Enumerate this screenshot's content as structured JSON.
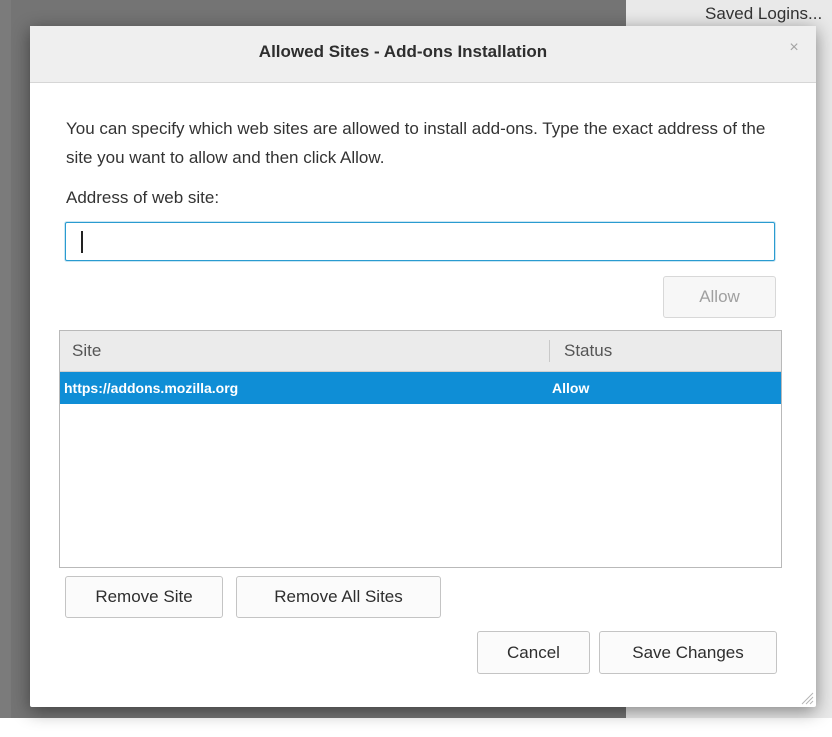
{
  "background": {
    "saved_logins_label": "Saved Logins..."
  },
  "dialog": {
    "title": "Allowed Sites - Add-ons Installation",
    "close_icon": "close-icon",
    "description": "You can specify which web sites are allowed to install add-ons. Type the exact address of the site you want to allow and then click Allow.",
    "address_label": "Address of web site:",
    "address_value": "",
    "address_placeholder": "",
    "allow_label": "Allow",
    "table": {
      "columns": [
        "Site",
        "Status"
      ],
      "rows": [
        {
          "site": "https://addons.mozilla.org",
          "status": "Allow"
        }
      ]
    },
    "remove_site_label": "Remove Site",
    "remove_all_label": "Remove All Sites",
    "cancel_label": "Cancel",
    "save_label": "Save Changes"
  },
  "colors": {
    "selection": "#0f8ed6",
    "focus_ring": "#2a9bd0",
    "titlebar": "#efefef"
  }
}
